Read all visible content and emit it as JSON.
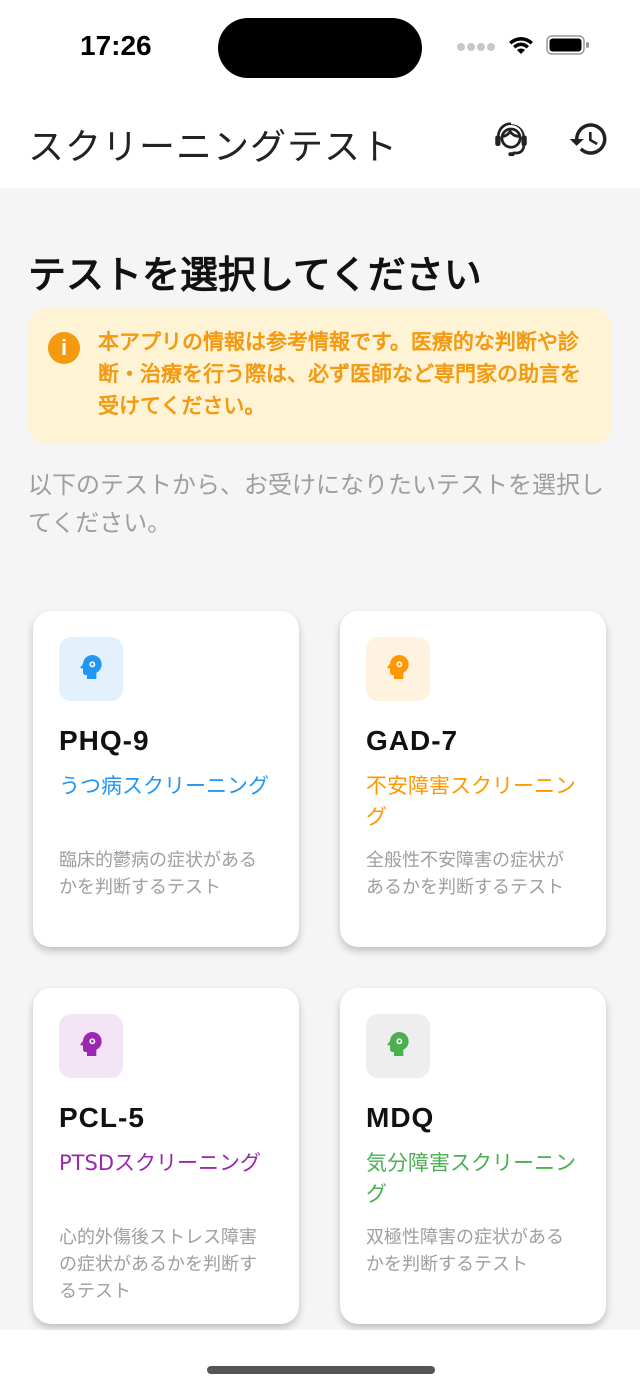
{
  "status_bar": {
    "time": "17:26"
  },
  "app_bar": {
    "title": "スクリーニングテスト",
    "support_icon": "headset-icon",
    "history_icon": "history-icon"
  },
  "section": {
    "title": "テストを選択してください",
    "notice": "本アプリの情報は参考情報です。医療的な判断や診断・治療を行う際は、必ず医師など専門家の助言を受けてください。",
    "notice_icon": "info-icon",
    "intro": "以下のテストから、お受けになりたいテストを選択してください。"
  },
  "tests": [
    {
      "name": "PHQ-9",
      "subtitle": "うつ病スクリーニング",
      "description": "臨床的鬱病の症状があるかを判断するテスト",
      "color": "#2196f3",
      "bg": "#e3f1fd",
      "icon": "psychology-icon"
    },
    {
      "name": "GAD-7",
      "subtitle": "不安障害スクリーニング",
      "description": "全般性不安障害の症状があるかを判断するテスト",
      "color": "#ff9800",
      "bg": "#fff3e0",
      "icon": "psychology-icon"
    },
    {
      "name": "PCL-5",
      "subtitle": "PTSDスクリーニング",
      "description": "心的外傷後ストレス障害の症状があるかを判断するテスト",
      "color": "#9c27b0",
      "bg": "#f3e5f5",
      "icon": "psychology-icon"
    },
    {
      "name": "MDQ",
      "subtitle": "気分障害スクリーニング",
      "description": "双極性障害の症状があるかを判断するテスト",
      "color": "#4caf50",
      "bg": "#eeeeee",
      "icon": "psychology-icon"
    }
  ]
}
